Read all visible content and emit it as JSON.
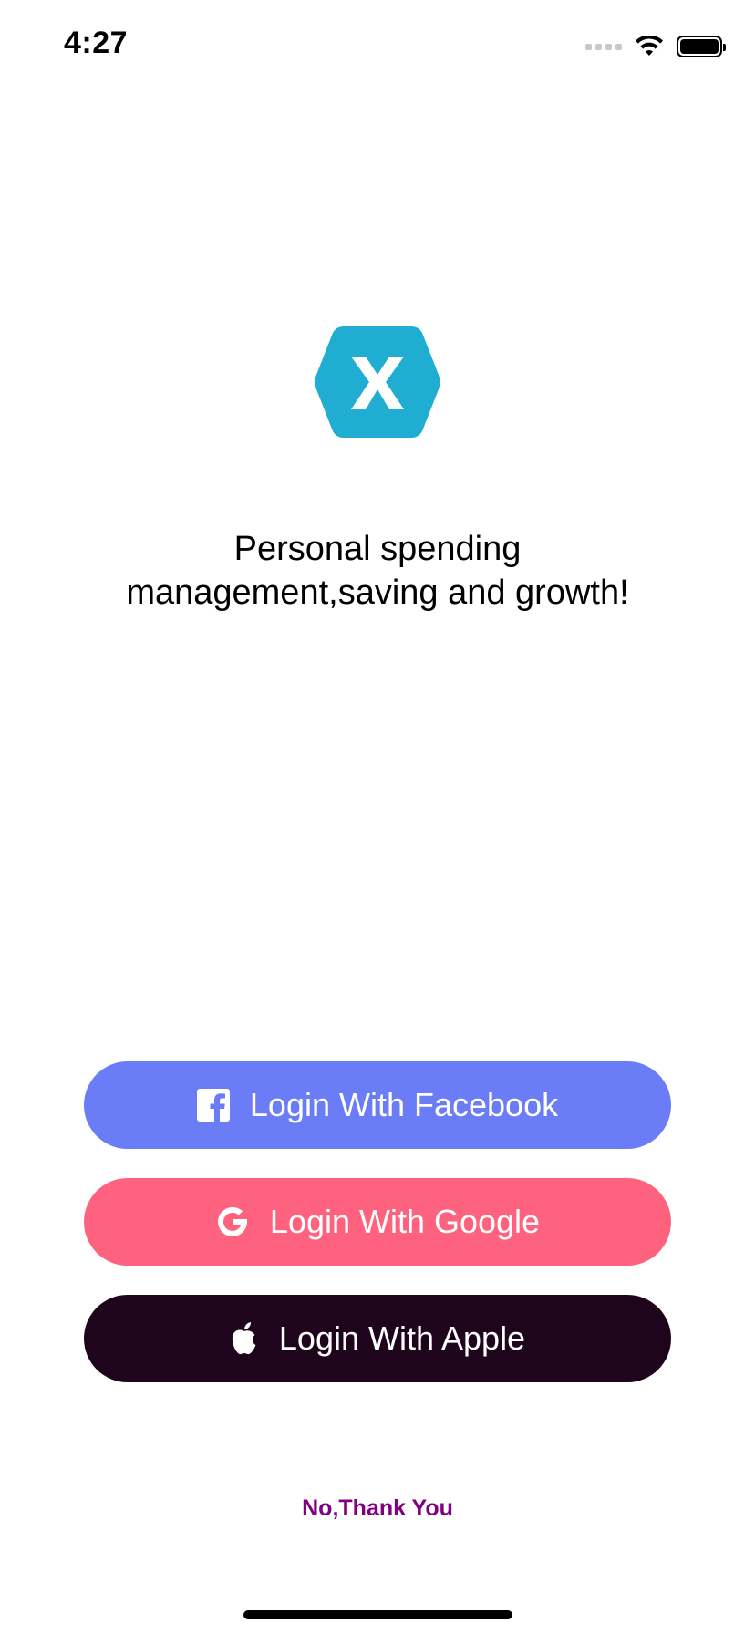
{
  "status_bar": {
    "time": "4:27"
  },
  "logo": {
    "icon": "xamarin-logo-icon",
    "letter": "X",
    "color": "#1fadd1"
  },
  "tagline": {
    "line1": "Personal spending",
    "line2": "management,saving and growth!"
  },
  "buttons": {
    "facebook": {
      "label": "Login With Facebook",
      "icon": "facebook-icon",
      "color": "#6b7cf7"
    },
    "google": {
      "label": "Login With Google",
      "icon": "google-icon",
      "color": "#ff627e"
    },
    "apple": {
      "label": "Login With Apple",
      "icon": "apple-icon",
      "color": "#1e051b"
    }
  },
  "skip": {
    "label": "No,Thank You",
    "color": "#800080"
  }
}
